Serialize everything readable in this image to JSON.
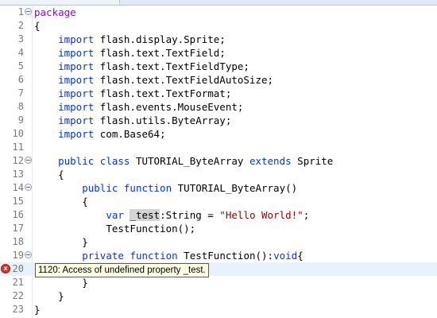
{
  "editor": {
    "lines": [
      {
        "num": "1",
        "kw": "package",
        "rest": ""
      },
      {
        "num": "2",
        "text": "{"
      },
      {
        "num": "3",
        "kw": "import",
        "rest": " flash.display.Sprite;"
      },
      {
        "num": "4",
        "kw": "import",
        "rest": " flash.text.TextField;"
      },
      {
        "num": "5",
        "kw": "import",
        "rest": " flash.text.TextFieldType;"
      },
      {
        "num": "6",
        "kw": "import",
        "rest": " flash.text.TextFieldAutoSize;"
      },
      {
        "num": "7",
        "kw": "import",
        "rest": " flash.text.TextFormat;"
      },
      {
        "num": "8",
        "kw": "import",
        "rest": " flash.events.MouseEvent;"
      },
      {
        "num": "9",
        "kw": "import",
        "rest": " flash.utils.ByteArray;"
      },
      {
        "num": "10",
        "kw": "import",
        "rest": " com.Base64;"
      },
      {
        "num": "11",
        "text": ""
      },
      {
        "num": "12",
        "kw1": "public",
        "kw2": "class",
        "mid": " TUTORIAL_ByteArray ",
        "kw3": "extends",
        "rest": " Sprite"
      },
      {
        "num": "13",
        "text": "{"
      },
      {
        "num": "14",
        "kw1": "public",
        "kw2": "function",
        "rest": " TUTORIAL_ByteArray()"
      },
      {
        "num": "15",
        "text": "{"
      },
      {
        "num": "16",
        "kw": "var",
        "ident": "_test",
        "type": ":String = ",
        "str": "\"Hello World!\"",
        "end": ";"
      },
      {
        "num": "17",
        "text": "TestFunction();"
      },
      {
        "num": "18",
        "text": "}"
      },
      {
        "num": "19",
        "kw1": "private",
        "kw2": "function",
        "rest": " TestFunction():",
        "kw3": "void",
        "end": "{"
      },
      {
        "num": "20",
        "text": ""
      },
      {
        "num": "21",
        "text": "}"
      },
      {
        "num": "22",
        "text": "}"
      },
      {
        "num": "23",
        "text": "}"
      }
    ],
    "error_tooltip": "1120: Access of undefined property _test.",
    "error_marker": "x"
  },
  "colors": {
    "keyword": "#0033ff",
    "package": "#9900cc",
    "string": "#990000",
    "current_line": "#e8f2fe"
  }
}
